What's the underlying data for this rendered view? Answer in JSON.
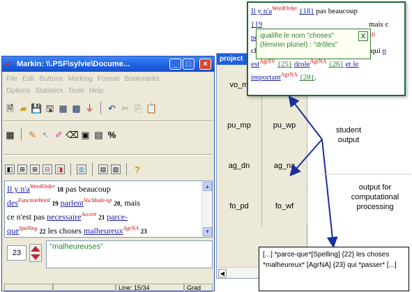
{
  "window": {
    "title": "Markin: \\\\.PSF\\sylvie\\Docume...",
    "app_icon": "checkmark-icon",
    "menu_row1": [
      "File",
      "Edit",
      "Buttons",
      "Marking",
      "Format",
      "Bookmarks"
    ],
    "menu_row2": [
      "Options",
      "Statistics",
      "Tools",
      "Help"
    ]
  },
  "toolbar1_icons": [
    "new-doc-icon",
    "open-folder-icon",
    "save-icon",
    "save-as-icon",
    "table-icon",
    "table-alt-icon",
    "filter-icon",
    "undo-icon",
    "cut-icon",
    "copy-icon",
    "paste-icon"
  ],
  "toolbar2": {
    "percent_label": "%"
  },
  "toolbar3": {
    "help_label": "?"
  },
  "document": {
    "words": {
      "w1": "Il y n'a",
      "t1": "WordOrder",
      "n1": "18",
      "w2": " pas  beaucoup",
      "w3": "des",
      "t3": "FunctionWord",
      "n3": "19",
      "w4": "parlent",
      "t4": "VocMode-up",
      "n4": "20",
      "w5": ", mais",
      "w6": "ce n'est pas ",
      "w7": "necessaire",
      "t7": "Accent",
      "n7": "21",
      "w8": "parce-",
      "w9": "que",
      "t9": "Spelling",
      "n9": "22",
      "w10": " les choses ",
      "w11": "malheureux",
      "t11": "AgrNA",
      "n11": "23"
    }
  },
  "spinner": {
    "value": "23"
  },
  "comment_value": "\"malheureuses\"",
  "status": {
    "line": "Line: 15/34",
    "mode": "Grad"
  },
  "project": {
    "title": "project",
    "rows": [
      [
        "vo_m",
        ""
      ],
      [
        "pu_mp",
        "pu_wp"
      ],
      [
        "ag_dn",
        "ag_na"
      ],
      [
        "fo_pd",
        "fo_wf"
      ]
    ]
  },
  "popup": {
    "p1": "Il y n'a",
    "t1": "WordOrder",
    "n1": "{18}",
    "p2": " pas beaucoup",
    "p3": "{19",
    "p4": " mais c",
    "p5": "nec",
    "p6": "ue",
    "t6": "Spell",
    "p7": "cho",
    "p8": ": qui ",
    "p9": "p",
    "p10": "est",
    "t10": "AgrSV",
    "n10": "{25}",
    "p11": "drole",
    "t11": "AgrNA",
    "n11": "{26}",
    "p12": "et le",
    "p13": "important",
    "t13": "AgrNA",
    "n13": "{28}",
    "p14": "."
  },
  "tooltip": {
    "text": "qualifie le nom \"choses\" (féminin pluriel) : \"drôles\"",
    "close": "X"
  },
  "annotations": {
    "student_output": "student\noutput",
    "computational": "output for\ncomputational\nprocessing"
  },
  "output_box": {
    "text": "[...] *parce-que*[Spelling] {22} les choses *malheureux* [AgrNA] {23} qui *passer* [...]"
  }
}
